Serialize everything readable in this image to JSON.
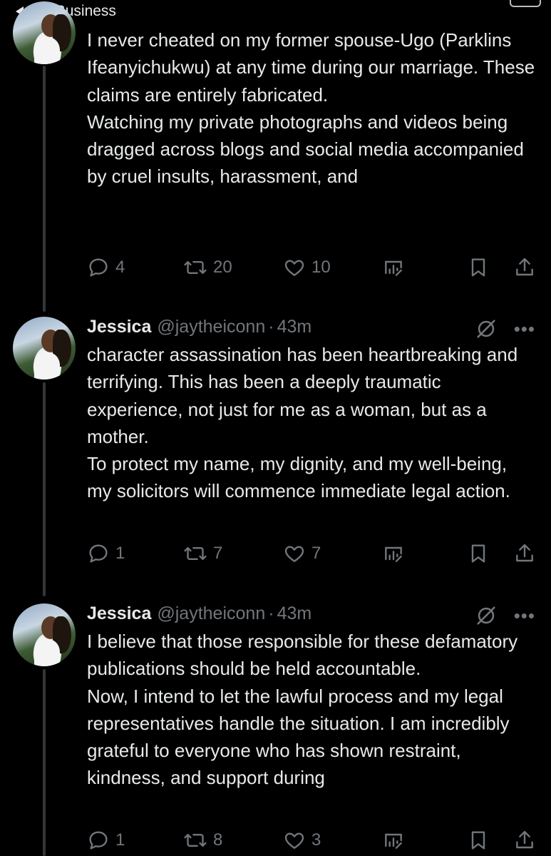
{
  "status_bar": {
    "back_label": "WA Business"
  },
  "tweets": [
    {
      "paragraphs": [
        "I never cheated on my former spouse-Ugo (Parklins Ifeanyichukwu) at any time during our marriage. These claims are entirely fabricated.",
        "Watching my private photographs and videos being dragged across blogs and social media accompanied by cruel insults, harassment, and"
      ],
      "replies": "4",
      "reposts": "20",
      "likes": "10"
    },
    {
      "name": "Jessica",
      "handle": "@jaytheiconn",
      "dot": "·",
      "time": "43m",
      "paragraphs": [
        "character assassination has been heartbreaking and terrifying. This has been a deeply traumatic experience, not just for me as a woman, but as a mother.",
        "To protect my name, my dignity, and my well-being, my solicitors will commence immediate legal action."
      ],
      "replies": "1",
      "reposts": "7",
      "likes": "7"
    },
    {
      "name": "Jessica",
      "handle": "@jaytheiconn",
      "dot": "·",
      "time": "43m",
      "paragraphs": [
        "I believe that those responsible for these defamatory publications should be held accountable.",
        "Now, I intend to let the lawful process and my legal representatives handle the situation. I am incredibly grateful to everyone who has shown restraint, kindness, and support during"
      ],
      "replies": "1",
      "reposts": "8",
      "likes": "3"
    }
  ],
  "icons": {
    "reply": "reply-icon",
    "repost": "repost-icon",
    "like": "heart-icon",
    "grok": "grok-icon",
    "more": "more-icon",
    "views": "views-icon",
    "bookmark": "bookmark-icon",
    "share": "share-icon"
  },
  "colors": {
    "background": "#000000",
    "text": "#e7e9ea",
    "muted": "#71767b",
    "thread_line": "#333639"
  }
}
